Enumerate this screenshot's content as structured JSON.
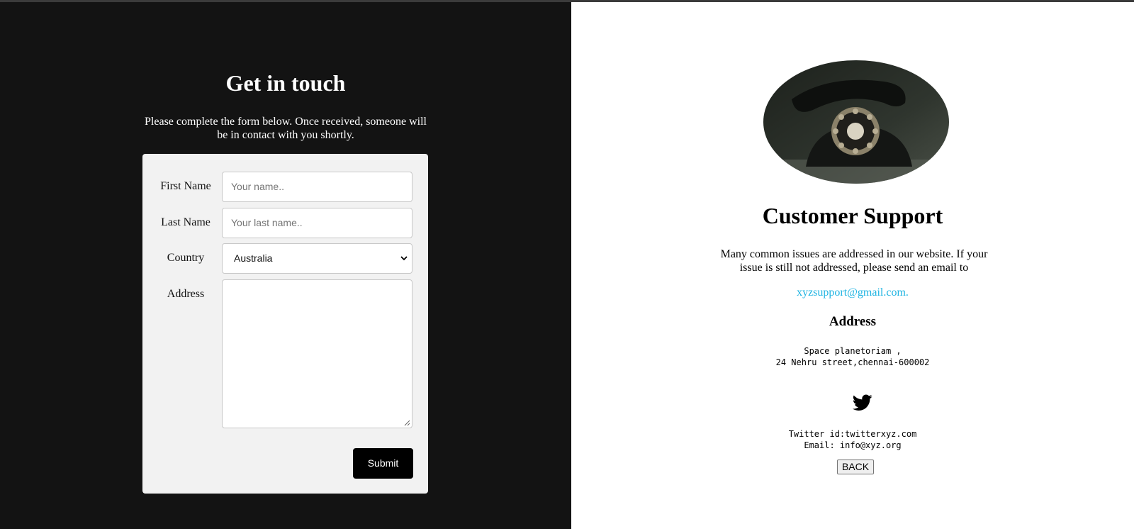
{
  "contact_form": {
    "title": "Get in touch",
    "intro": "Please complete the form below. Once received, someone will be in contact with you shortly.",
    "first_name": {
      "label": "First Name",
      "placeholder": "Your name.."
    },
    "last_name": {
      "label": "Last Name",
      "placeholder": "Your last name.."
    },
    "country": {
      "label": "Country",
      "value": "Australia"
    },
    "address": {
      "label": "Address",
      "value": ""
    },
    "submit_label": "Submit"
  },
  "support": {
    "title": "Customer Support",
    "description": "Many common issues are addressed in our website. If your issue is still not addressed, please send an email to",
    "email": "xyzsupport@gmail.com.",
    "address_heading": "Address",
    "address_line1": "Space planetoriam ,",
    "address_line2": "24 Nehru street,chennai-600002",
    "twitter_line": "Twitter id:twitterxyz.com",
    "email_line": "Email: info@xyz.org",
    "back_label": "BACK"
  },
  "icons": {
    "phone_image": "rotary-telephone-image",
    "twitter": "twitter-icon",
    "select_arrow": "chevron-down-icon"
  },
  "colors": {
    "left_background": "#131313",
    "form_card": "#f2f2f2",
    "submit_button": "#000000",
    "link": "#1fb4e2"
  }
}
